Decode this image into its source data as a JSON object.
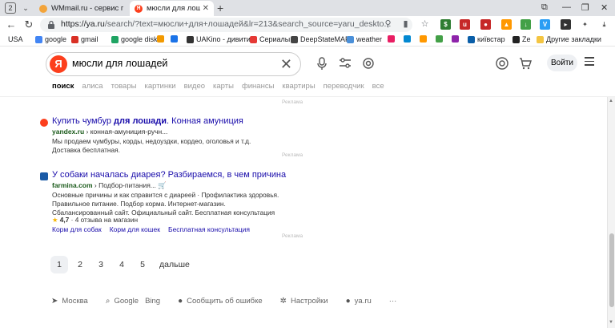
{
  "browser": {
    "tab_count": "2",
    "tabs": [
      {
        "title": "WMmail.ru - сервис почт",
        "favicon_color": "#f3a43a"
      },
      {
        "title": "мюсли для лошадей",
        "favicon_color": "#fc3f1d"
      }
    ],
    "url_host": "https://ya.ru",
    "url_path": "/search/?text=мюсли+для+лошадей&lr=213&search_source=yaru_deskto..."
  },
  "bookmarks": [
    {
      "label": "USA",
      "color": ""
    },
    {
      "label": "google",
      "color": "#4285f4"
    },
    {
      "label": "gmail",
      "color": "#d93025"
    },
    {
      "label": "google disk",
      "color": "#1fa463"
    },
    {
      "label": "",
      "color": "#f29900"
    },
    {
      "label": "",
      "color": "#1b73e8"
    },
    {
      "label": "UAKino - дивити",
      "color": "#333"
    },
    {
      "label": "Сериалы",
      "color": "#e53935"
    },
    {
      "label": "DeepStateMAP",
      "color": "#444"
    },
    {
      "label": "weather",
      "color": "#4a90d9"
    },
    {
      "label": "",
      "color": "#e91e63"
    },
    {
      "label": "",
      "color": "#0288d1"
    },
    {
      "label": "",
      "color": "#ff9800"
    },
    {
      "label": "",
      "color": "#43a047"
    },
    {
      "label": "",
      "color": "#8e24aa"
    },
    {
      "label": "київстар",
      "color": "#0a5ea8"
    },
    {
      "label": "Ze",
      "color": "#222"
    },
    {
      "label": "Другие закладки",
      "color": "#f4c542"
    }
  ],
  "yandex": {
    "logo": "Я",
    "query": "мюсли для лошадей",
    "login": "Войти",
    "tabs": [
      "поиск",
      "алиса",
      "товары",
      "картинки",
      "видео",
      "карты",
      "финансы",
      "квартиры",
      "переводчик",
      "все"
    ]
  },
  "results": [
    {
      "title_pre": "Купить чумбур ",
      "title_bold": "для лошади",
      "title_post": ". Конная амуниция",
      "domain": "yandex.ru",
      "path": "› конная-амуниция-ручн...",
      "snippet": "Мы продаем чумбуры, корды, недоуздки, кордео, оголовья и т.д. Доставка бесплатная.",
      "favicon_color": "#fc3f1d",
      "ad_label": "Реклама"
    },
    {
      "title_pre": "У собаки началась диарея? Разбираемся, в чем причина",
      "title_bold": "",
      "title_post": "",
      "domain": "farmina.com",
      "path": "› Подбор-питания...",
      "snippet": "Основные причины и как справится с диареей · Профилактика здоровья. Правильное питание. Подбор корма. Интернет-магазин. Сбалансированный сайт. Официальный сайт. Бесплатная консультация",
      "favicon_color": "#1a5aa6",
      "rating": "4,7",
      "rating_text": "· 4 отзыва на магазин",
      "sitelinks": [
        "Корм для собак",
        "Корм для кошек",
        "Бесплатная консультация"
      ],
      "ad_label": "Реклама"
    }
  ],
  "pager": {
    "pages": [
      "1",
      "2",
      "3",
      "4",
      "5"
    ],
    "current": "1",
    "next": "дальше"
  },
  "footer": [
    {
      "icon": "location-arrow-icon",
      "glyph": "➤",
      "label": "Москва"
    },
    {
      "icon": "search-icon",
      "glyph": "⌕",
      "label": "Google"
    },
    {
      "icon": "",
      "glyph": "",
      "label": "Bing"
    },
    {
      "icon": "alert-icon",
      "glyph": "●",
      "label": "Сообщить об ошибке"
    },
    {
      "icon": "gear-icon",
      "glyph": "✲",
      "label": "Настройки"
    },
    {
      "icon": "ya-icon",
      "glyph": "●",
      "label": "ya.ru"
    },
    {
      "icon": "more-icon",
      "glyph": "",
      "label": "···"
    }
  ]
}
